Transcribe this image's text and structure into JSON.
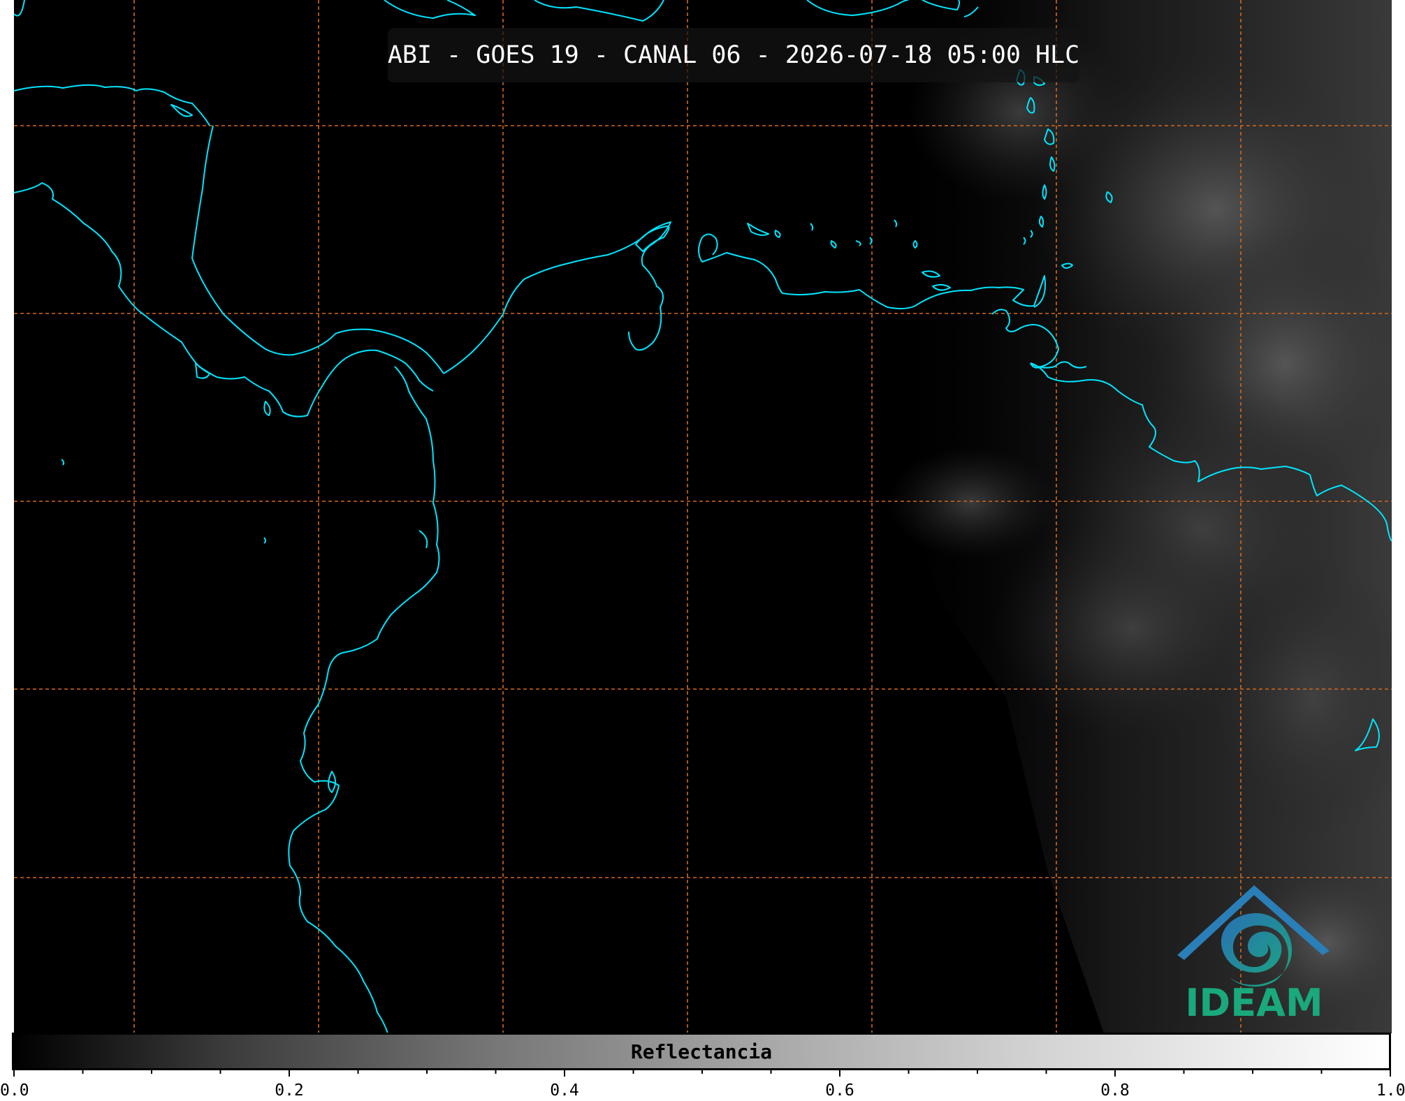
{
  "title": "ABI - GOES 19 - CANAL 06 - 2026-07-18 05:00 HLC",
  "colorbar": {
    "label": "Reflectancia",
    "tick_labels": [
      "0.0",
      "0.2",
      "0.4",
      "0.6",
      "0.8",
      "1.0"
    ],
    "colors": [
      "#000000",
      "#ffffff"
    ]
  },
  "logo": {
    "text": "IDEAM",
    "colors": [
      "#2a6fb5",
      "#19a97c"
    ]
  },
  "map": {
    "coastline_color": "#00e5ff",
    "gridline_color": "#d2691e",
    "background_color": "#000000",
    "gridlines": "dashed"
  }
}
